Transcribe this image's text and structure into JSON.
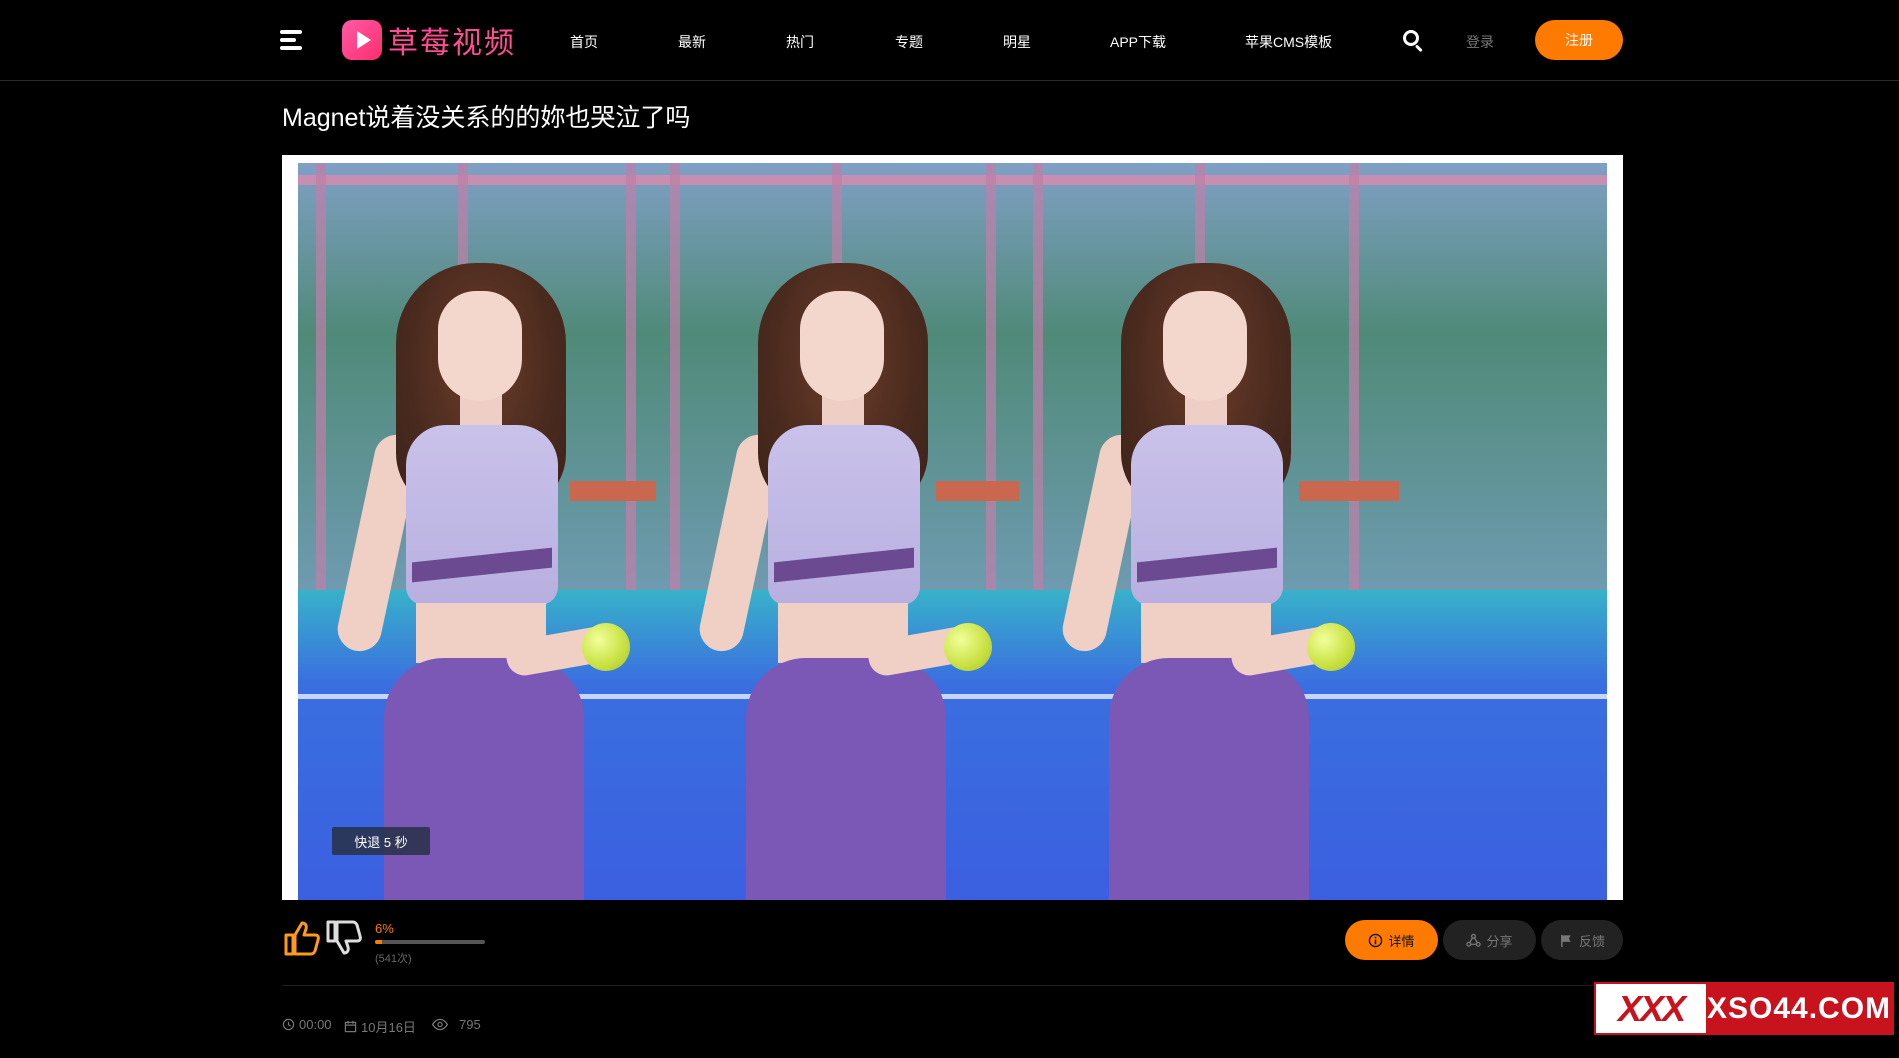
{
  "header": {
    "logo_text": "草莓视频",
    "nav": [
      {
        "label": "首页"
      },
      {
        "label": "最新"
      },
      {
        "label": "热门"
      },
      {
        "label": "专题"
      },
      {
        "label": "明星"
      },
      {
        "label": "APP下载"
      },
      {
        "label": "苹果CMS模板"
      }
    ],
    "login_label": "登录",
    "register_label": "注册",
    "accent_color": "#ff7a00",
    "logo_color": "#ff4d94"
  },
  "video": {
    "title": "Magnet说着没关系的的妳也哭泣了吗",
    "rewind_tip": "快退 5 秒"
  },
  "rating": {
    "percent_label": "6%",
    "percent_value": 6,
    "count_label": "(541次)"
  },
  "actions": {
    "detail_label": "详情",
    "share_label": "分享",
    "feedback_label": "反馈"
  },
  "meta": {
    "duration": "00:00",
    "date": "10月16日",
    "views": "795"
  },
  "watermark": {
    "logo_text": "XXX",
    "text": "XSO44.COM",
    "color": "#c8131e"
  }
}
